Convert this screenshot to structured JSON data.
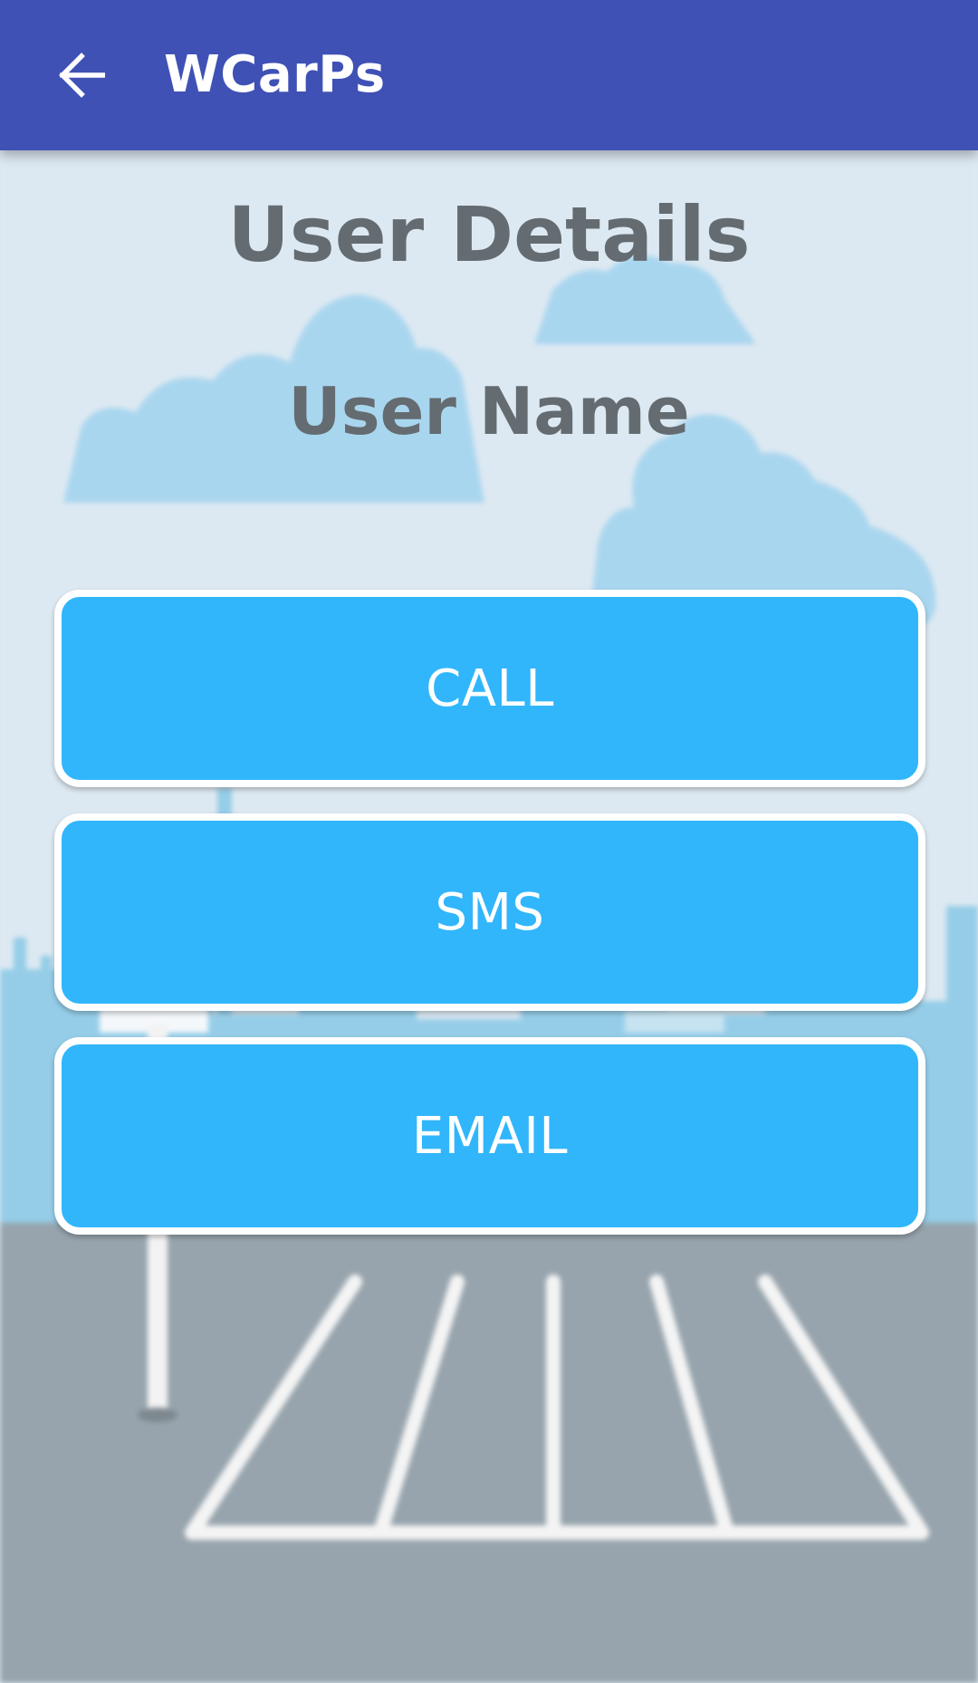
{
  "app_bar": {
    "title": "WCarPs",
    "back_icon": "arrow-back-icon",
    "color": "#3f51b5"
  },
  "content": {
    "heading": "User Details",
    "user_name": "User Name"
  },
  "actions": {
    "call_label": "CALL",
    "sms_label": "SMS",
    "email_label": "EMAIL",
    "button_color": "#31b6fc"
  },
  "colors": {
    "text_gray": "#646c71",
    "sky": "#dde9f2",
    "clouds": "#a9d6ef",
    "asphalt": "#97a4ad"
  }
}
